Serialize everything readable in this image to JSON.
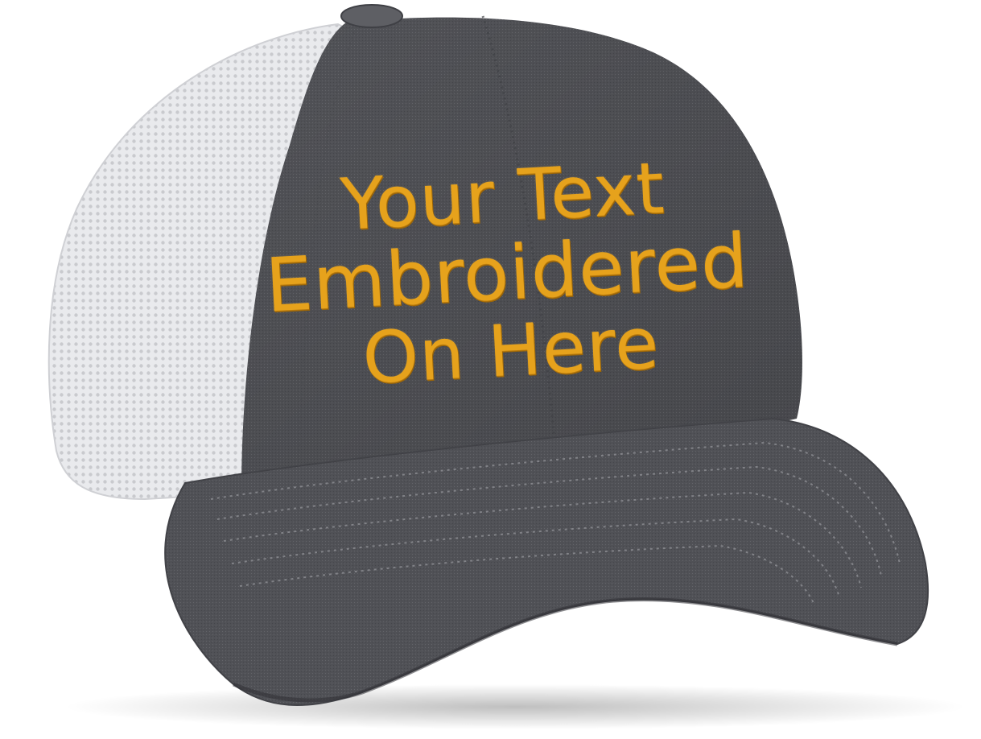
{
  "product": {
    "type": "trucker-cap",
    "colors": {
      "crown": "#55565b",
      "brim": "#5b5c61",
      "mesh": "#e8e9ec",
      "thread": "#e6a21c",
      "background": "#ffffff"
    }
  },
  "embroidery": {
    "line1": "Your Text",
    "line2": "Embroidered",
    "line3": "On Here"
  }
}
